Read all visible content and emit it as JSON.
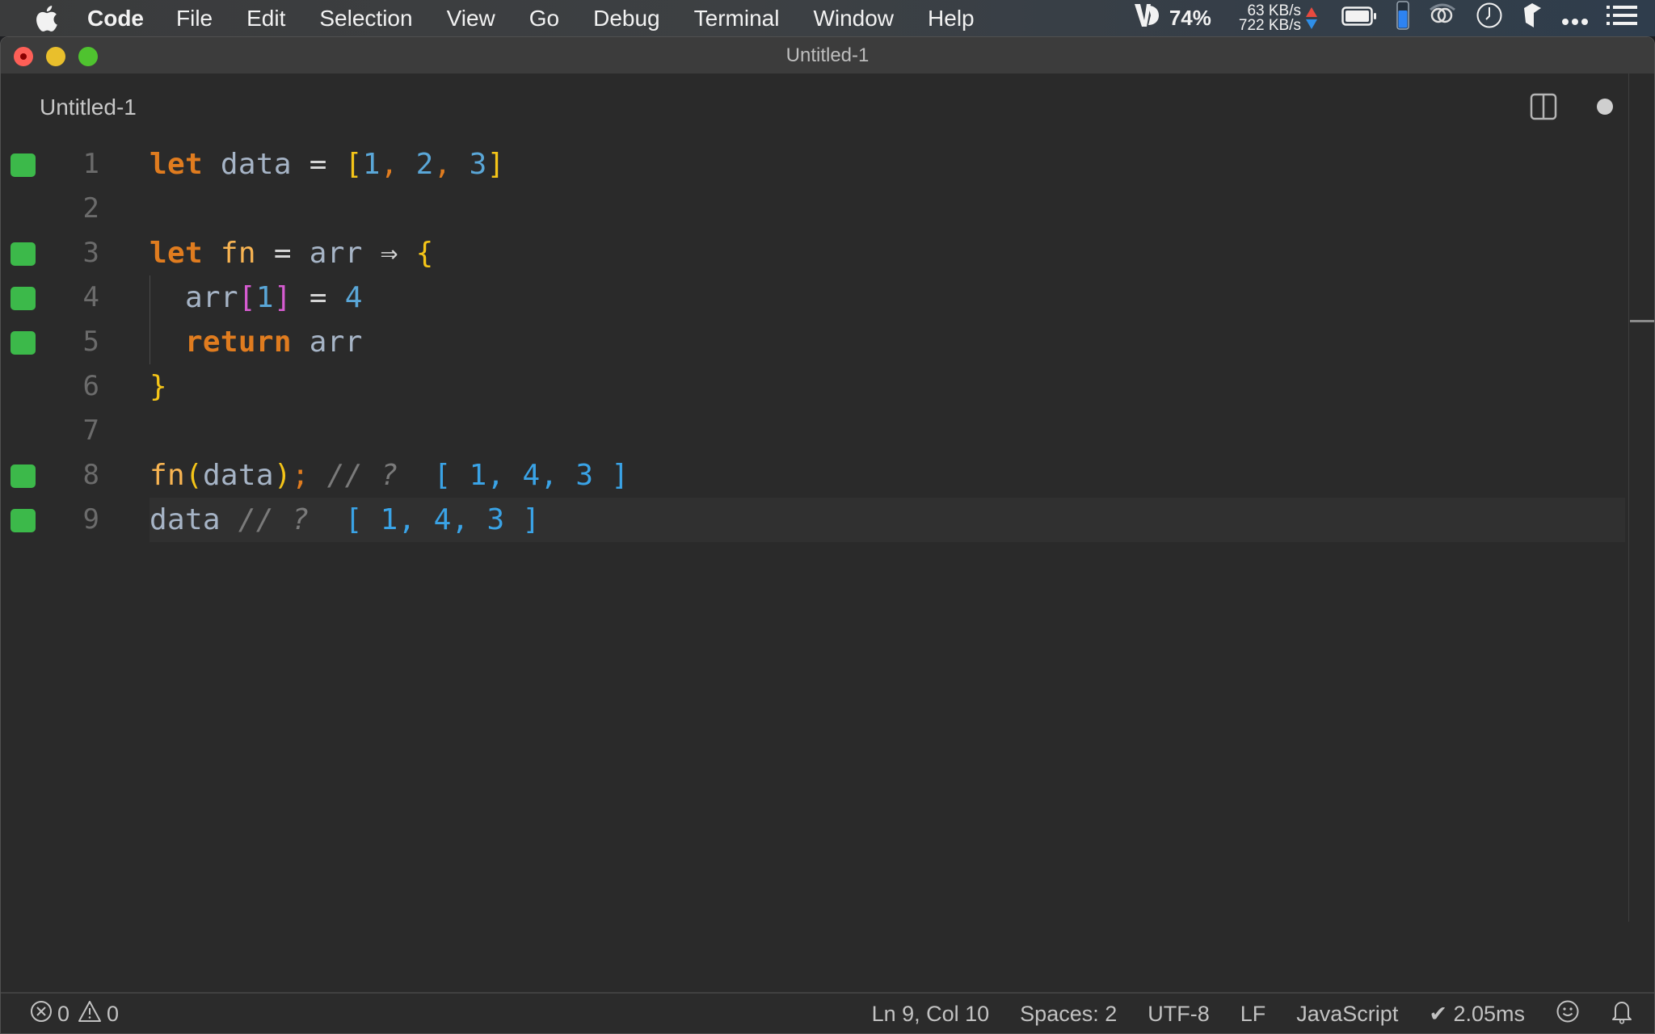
{
  "menubar": {
    "app_name": "Code",
    "items": [
      "File",
      "Edit",
      "Selection",
      "View",
      "Go",
      "Debug",
      "Terminal",
      "Window",
      "Help"
    ],
    "tray": {
      "vd_percent": "74%",
      "upload_speed": "63 KB/s",
      "download_speed": "722 KB/s",
      "icons": [
        "vd-icon",
        "upload-arrow-icon",
        "download-arrow-icon",
        "battery-icon",
        "memory-gauge-icon",
        "creative-cloud-icon",
        "clock-icon",
        "app-icon",
        "more-icon",
        "list-icon"
      ]
    }
  },
  "window": {
    "title": "Untitled-1",
    "tab_label": "Untitled-1"
  },
  "editor": {
    "current_line": 9,
    "lines": [
      {
        "number": "1",
        "covered": true
      },
      {
        "number": "2",
        "covered": false
      },
      {
        "number": "3",
        "covered": true
      },
      {
        "number": "4",
        "covered": true
      },
      {
        "number": "5",
        "covered": true
      },
      {
        "number": "6",
        "covered": false
      },
      {
        "number": "7",
        "covered": false
      },
      {
        "number": "8",
        "covered": true
      },
      {
        "number": "9",
        "covered": true
      }
    ],
    "tokens": {
      "l1": [
        "let",
        " data ",
        "=",
        " ",
        "[",
        "1",
        ",",
        " ",
        "2",
        ",",
        " ",
        "3",
        "]"
      ],
      "l3": [
        "let",
        " ",
        "fn",
        " ",
        "=",
        " arr ",
        "⇒",
        " ",
        "{"
      ],
      "l4": [
        "  arr",
        "[",
        "1",
        "]",
        " ",
        "=",
        " ",
        "4"
      ],
      "l5": [
        "  ",
        "return",
        " arr"
      ],
      "l6": [
        "}"
      ],
      "l8": [
        "fn",
        "(",
        "data",
        ")",
        ";",
        " // ? ",
        " [ 1, 4, 3 ]"
      ],
      "l9": [
        "data",
        " // ? ",
        " [ 1, 4, 3 ]"
      ]
    }
  },
  "statusbar": {
    "errors": "0",
    "warnings": "0",
    "cursor": "Ln 9, Col 10",
    "indent": "Spaces: 2",
    "encoding": "UTF-8",
    "eol": "LF",
    "language": "JavaScript",
    "timing": "✔ 2.05ms"
  },
  "colors": {
    "coverage": "#3cb94a",
    "keyword": "#e07c1f",
    "function": "#f8b452",
    "number": "#5aa7d8",
    "result": "#3aa3e6",
    "bracket_yellow": "#f5c518",
    "bracket_pink": "#d65cd1"
  }
}
